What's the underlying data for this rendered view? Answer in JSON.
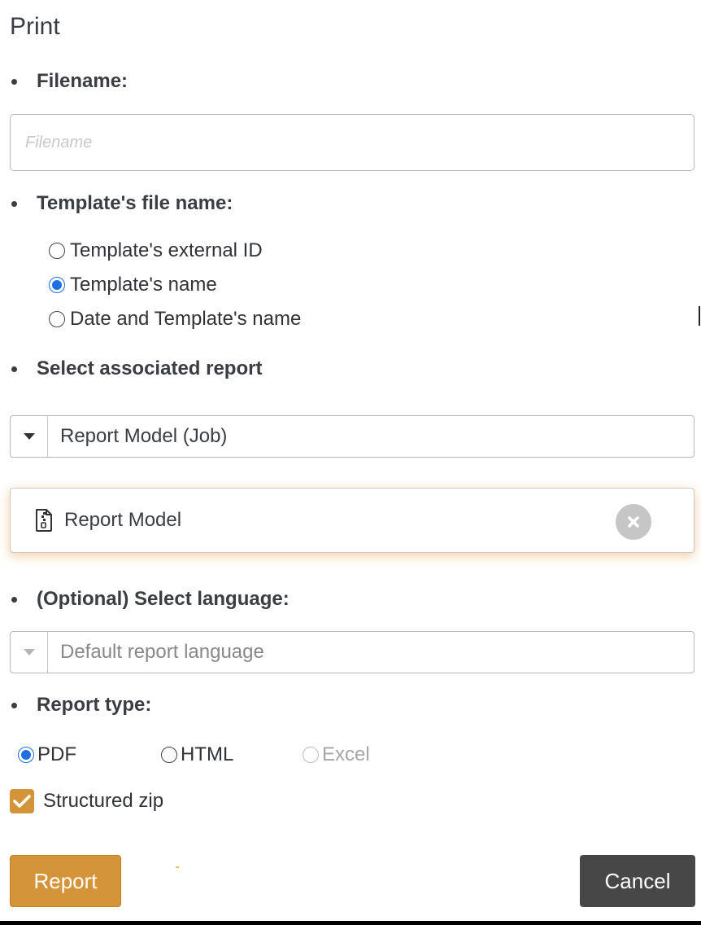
{
  "dialog": {
    "title": "Print"
  },
  "filename": {
    "label": "Filename:",
    "placeholder": "Filename",
    "value": ""
  },
  "template_file_name": {
    "label": "Template's file name:",
    "options": [
      {
        "label": "Template's external ID",
        "checked": false
      },
      {
        "label": "Template's name",
        "checked": true
      },
      {
        "label": "Date and Template's name",
        "checked": false
      }
    ]
  },
  "associated_report": {
    "label": "Select associated report",
    "selected": "Report Model (Job)",
    "chip": {
      "icon": "document-icon",
      "label": "Report Model"
    }
  },
  "language": {
    "label": "(Optional) Select language:",
    "selected": "Default report language"
  },
  "report_type": {
    "label": "Report type:",
    "options": [
      {
        "label": "PDF",
        "checked": true,
        "disabled": false
      },
      {
        "label": "HTML",
        "checked": false,
        "disabled": false
      },
      {
        "label": "Excel",
        "checked": false,
        "disabled": true
      }
    ]
  },
  "structured_zip": {
    "label": "Structured zip",
    "checked": true
  },
  "actions": {
    "report_label": "Report",
    "cancel_label": "Cancel"
  },
  "colors": {
    "accent": "#d4953a",
    "radio_selected": "#1f6fe5",
    "cancel_bg": "#474747",
    "chip_glow": "#e8a85c"
  }
}
